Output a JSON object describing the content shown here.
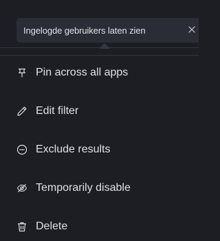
{
  "filter_pill": {
    "label": "Ingelogde gebruikers laten zien",
    "close_icon": "close-icon"
  },
  "menu": {
    "items": [
      {
        "label": "Pin across all apps",
        "icon": "pin-icon"
      },
      {
        "label": "Edit filter",
        "icon": "pencil-icon"
      },
      {
        "label": "Exclude results",
        "icon": "minus-circle-icon"
      },
      {
        "label": "Temporarily disable",
        "icon": "eye-closed-icon"
      },
      {
        "label": "Delete",
        "icon": "trash-icon"
      }
    ]
  },
  "colors": {
    "background": "#1d1e24",
    "pill_background": "#2b2d36",
    "text": "#dfe1e7",
    "border": "#343741"
  }
}
